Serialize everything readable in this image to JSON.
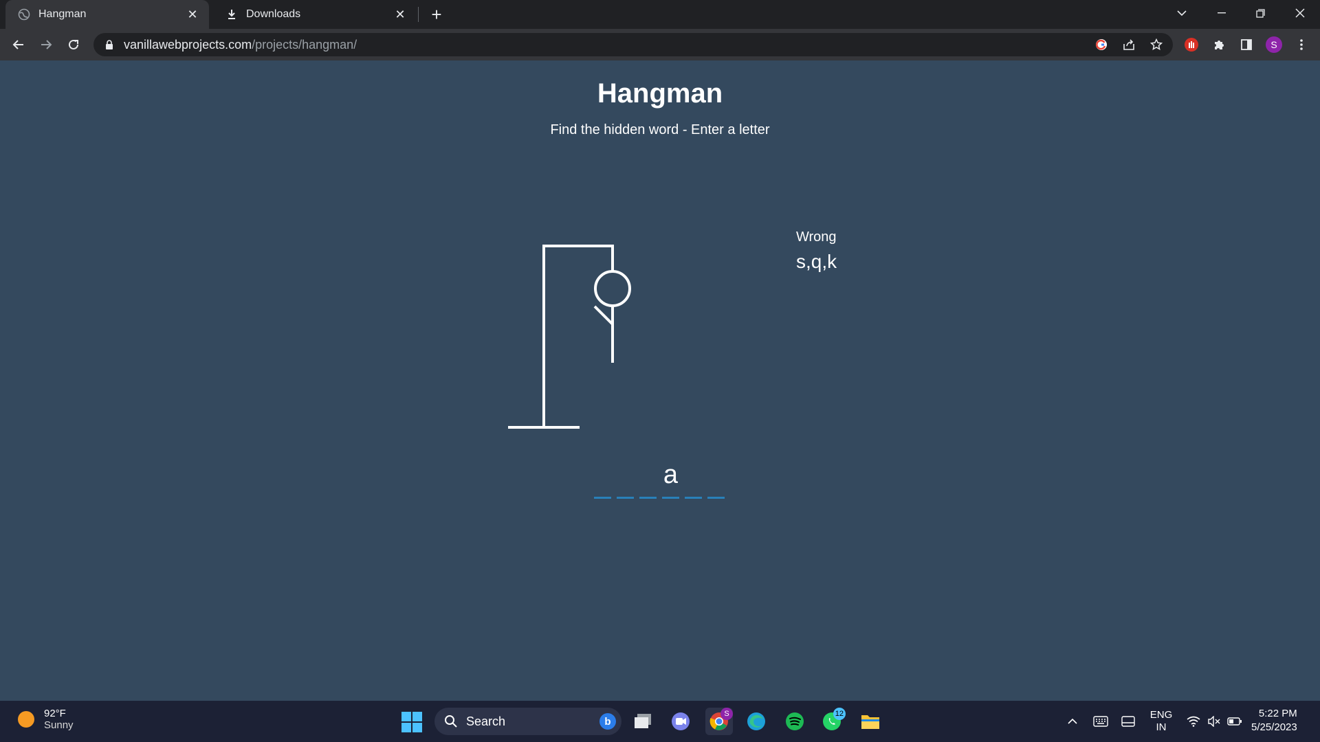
{
  "browser": {
    "tabs": [
      {
        "label": "Hangman",
        "active": true,
        "icon": "globe-icon"
      },
      {
        "label": "Downloads",
        "active": false,
        "icon": "download-icon"
      }
    ],
    "url_host": "vanillawebprojects.com",
    "url_path": "/projects/hangman/",
    "profile_initial": "S"
  },
  "game": {
    "title": "Hangman",
    "subtitle": "Find the hidden word - Enter a letter",
    "wrong_label": "Wrong",
    "wrong_letters": "s,q,k",
    "word_slots": [
      "",
      "",
      "",
      "a",
      "",
      ""
    ],
    "parts_shown": [
      "head",
      "body",
      "left-arm"
    ]
  },
  "taskbar": {
    "weather_temp": "92°F",
    "weather_condition": "Sunny",
    "search_placeholder": "Search",
    "whatsapp_badge": "12",
    "chrome_badge": "S",
    "lang_top": "ENG",
    "lang_bottom": "IN",
    "time": "5:22 PM",
    "date": "5/25/2023"
  },
  "colors": {
    "page_bg": "#34495e",
    "underline": "#2980b9",
    "chrome_dark": "#202124",
    "chrome_toolbar": "#35363a",
    "taskbar_bg": "#1c2135"
  }
}
